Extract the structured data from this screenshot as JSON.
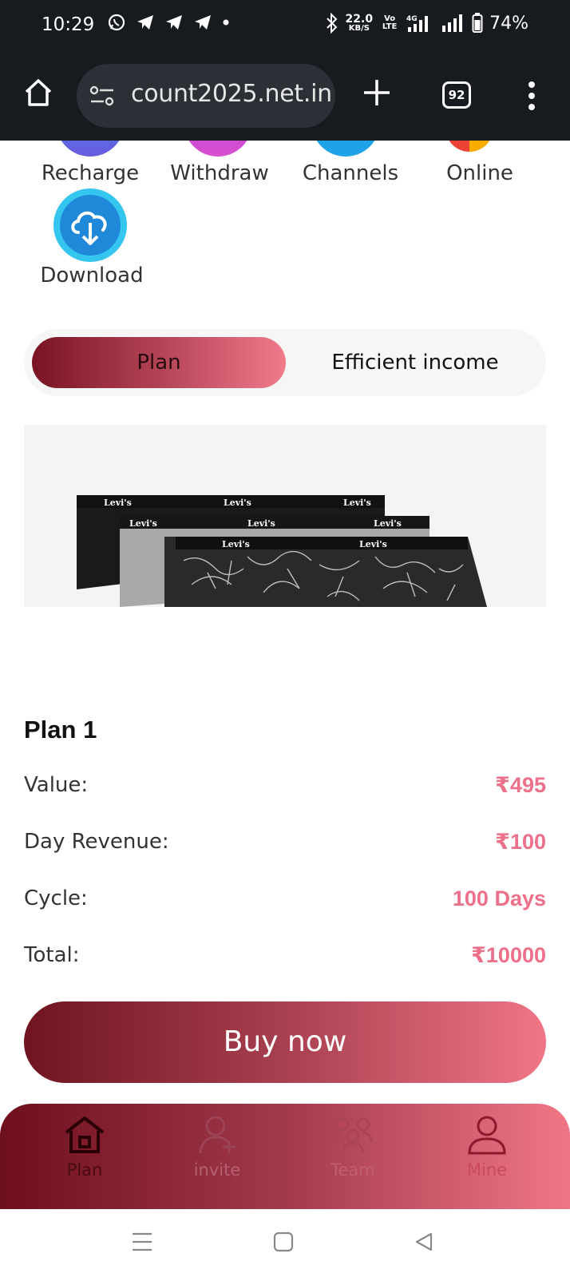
{
  "status_bar": {
    "time": "10:29",
    "speed_value": "22.0",
    "speed_unit": "KB/S",
    "volte": "Vo LTE",
    "network": "4G",
    "battery": "74%"
  },
  "browser": {
    "url": "count2025.net.in",
    "tab_count": "92"
  },
  "quick_actions": [
    {
      "label": "Recharge",
      "color": "#4b6fe0"
    },
    {
      "label": "Withdraw",
      "color": "#c14fd2"
    },
    {
      "label": "Channels",
      "color": "#1fa3e8"
    },
    {
      "label": "Online",
      "color": "#34a853"
    },
    {
      "label": "Download",
      "color": "#1f88d8"
    }
  ],
  "tabs": {
    "plan": "Plan",
    "income": "Efficient income"
  },
  "product_image": {
    "brand_text": "Levi's",
    "description": "Levi's boxer briefs"
  },
  "plan": {
    "title": "Plan 1",
    "rows": [
      {
        "label": "Value:",
        "value": "₹495"
      },
      {
        "label": "Day Revenue:",
        "value": "₹100"
      },
      {
        "label": "Cycle:",
        "value": "100 Days"
      },
      {
        "label": "Total:",
        "value": "₹10000"
      }
    ],
    "buy_label": "Buy now"
  },
  "bottom_nav": [
    {
      "label": "Plan",
      "icon": "house-icon",
      "active": true
    },
    {
      "label": "invite",
      "icon": "user-add-icon"
    },
    {
      "label": "Team",
      "icon": "team-icon"
    },
    {
      "label": "Mine",
      "icon": "person-icon"
    }
  ],
  "accent_color": "#ec7089"
}
